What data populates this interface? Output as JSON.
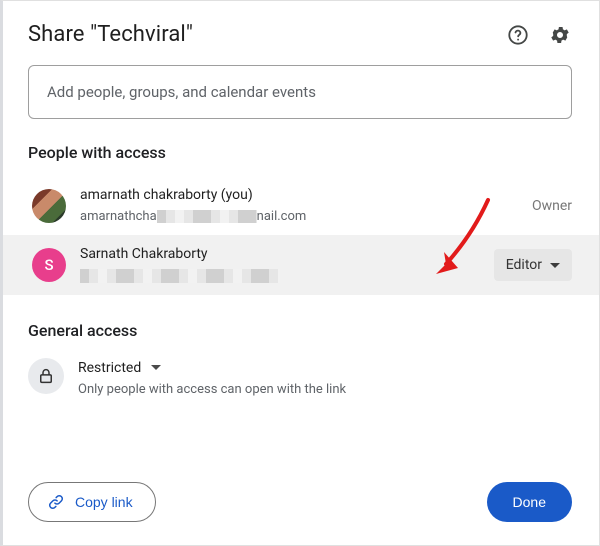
{
  "header": {
    "title": "Share \"Techviral\""
  },
  "search": {
    "placeholder": "Add people, groups, and calendar events"
  },
  "sections": {
    "people_title": "People with access",
    "general_title": "General access"
  },
  "people": [
    {
      "name": "amarnath chakraborty (you)",
      "email_visible_prefix": "amarnathcha",
      "email_visible_suffix": "nail.com",
      "avatar_initial": "",
      "role": "Owner",
      "highlighted": false
    },
    {
      "name": "Sarnath Chakraborty",
      "avatar_initial": "S",
      "role": "Editor",
      "highlighted": true
    }
  ],
  "general": {
    "mode": "Restricted",
    "description": "Only people with access can open with the link"
  },
  "footer": {
    "copy_link": "Copy link",
    "done": "Done"
  },
  "colors": {
    "accent": "#1a5ac8",
    "avatar_pink": "#e83e8c",
    "arrow": "#e21b1b"
  }
}
